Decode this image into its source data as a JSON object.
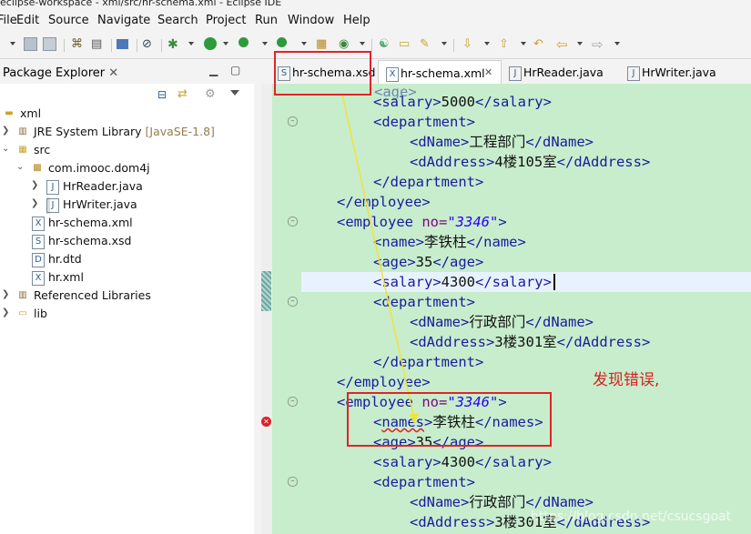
{
  "window_title": "eclipse-workspace - xml/src/hr-schema.xml - Eclipse IDE",
  "menu": [
    "File",
    "Edit",
    "Source",
    "Navigate",
    "Search",
    "Project",
    "Run",
    "Window",
    "Help"
  ],
  "left_panel": {
    "title": "Package Explorer",
    "tree": [
      {
        "label": "xml",
        "icon": "project-folder-icon"
      },
      {
        "label": "JRE System Library",
        "decoration": "[JavaSE-1.8]",
        "icon": "library-icon"
      },
      {
        "label": "src",
        "icon": "source-folder-icon"
      },
      {
        "label": "com.imooc.dom4j",
        "icon": "package-icon"
      },
      {
        "label": "HrReader.java",
        "icon": "java-file-icon"
      },
      {
        "label": "HrWriter.java",
        "icon": "java-file-icon"
      },
      {
        "label": "hr-schema.xml",
        "icon": "xml-file-icon"
      },
      {
        "label": "hr-schema.xsd",
        "icon": "xsd-file-icon"
      },
      {
        "label": "hr.dtd",
        "icon": "dtd-file-icon"
      },
      {
        "label": "hr.xml",
        "icon": "xml-file-icon"
      },
      {
        "label": "Referenced Libraries",
        "icon": "library-icon"
      },
      {
        "label": "lib",
        "icon": "folder-icon"
      }
    ]
  },
  "editor_tabs": [
    {
      "label": "hr-schema.xsd",
      "icon": "xsd-file-icon"
    },
    {
      "label": "hr-schema.xml",
      "icon": "xml-file-icon",
      "close": "✕"
    },
    {
      "label": "HrReader.java",
      "icon": "java-file-icon"
    },
    {
      "label": "HrWriter.java",
      "icon": "java-file-icon"
    }
  ],
  "code": {
    "salary1": "5000",
    "dname1": "工程部门",
    "daddr1": "4楼105室",
    "emp2_no": "\"3346\"",
    "name2": "李铁柱",
    "age2": "35",
    "salary2": "4300",
    "dname2": "行政部门",
    "daddr2": "3楼301室",
    "emp3_no": "\"3346\"",
    "name3": "李铁柱",
    "age3": "35",
    "salary3": "4300",
    "dname3": "行政部门",
    "daddr3": "3楼301室"
  },
  "annotation": "发现错误,",
  "watermark": "https://blog.csdn.net/csucsgoat",
  "colors": {
    "editor_bg": "#c7edcc",
    "tag": "#1a1a9e",
    "attr": "#7f007f",
    "value": "#2a00ff",
    "annotation": "#d42020"
  }
}
